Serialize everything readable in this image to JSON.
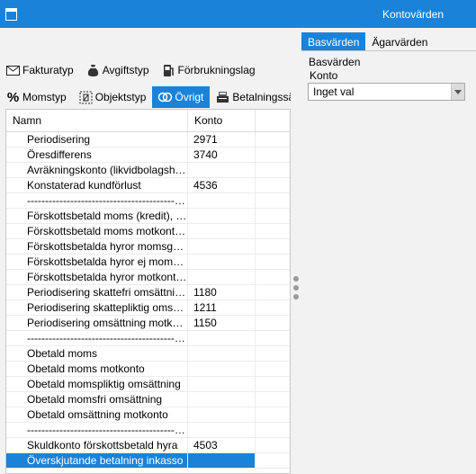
{
  "window": {
    "title": "Kontovärden"
  },
  "tabs_top": [
    {
      "label": "Fakturatyp",
      "icon": "envelope-icon"
    },
    {
      "label": "Avgiftstyp",
      "icon": "money-bag-icon"
    },
    {
      "label": "Förbrukningslag",
      "icon": "pump-icon"
    }
  ],
  "tabs_bottom": [
    {
      "label": "Momstyp",
      "icon": "percent-icon"
    },
    {
      "label": "Objektstyp",
      "icon": "object-icon"
    },
    {
      "label": "Övrigt",
      "icon": "rings-icon",
      "active": true
    },
    {
      "label": "Betalningssätt",
      "icon": "cash-register-icon"
    }
  ],
  "grid": {
    "columns": [
      "Namn",
      "Konto"
    ],
    "rows": [
      {
        "name": "Periodisering",
        "account": "2971"
      },
      {
        "name": "Öresdifferens",
        "account": "3740"
      },
      {
        "name": "Avräkningskonto (likvidbolagshantering)",
        "account": ""
      },
      {
        "name": "Konstaterad kundförlust",
        "account": "4536"
      },
      {
        "name": "--------------------------------------------------------",
        "account": ""
      },
      {
        "name": "Förskottsbetald moms (kredit), användning",
        "account": ""
      },
      {
        "name": "Förskottsbetald moms motkonto (debet)",
        "account": ""
      },
      {
        "name": "Förskottsbetalda hyror momsgrundande",
        "account": ""
      },
      {
        "name": "Förskottsbetalda hyror ej momsgrundande",
        "account": ""
      },
      {
        "name": "Förskottsbetalda hyror motkonto (debet)",
        "account": ""
      },
      {
        "name": "Periodisering skattefri omsättning (kredit)",
        "account": "1180"
      },
      {
        "name": "Periodisering skattepliktig omsättning",
        "account": "1211"
      },
      {
        "name": "Periodisering omsättning motkonto (debet)",
        "account": "1150"
      },
      {
        "name": "--------------------------------------------------------",
        "account": ""
      },
      {
        "name": "Obetald moms",
        "account": ""
      },
      {
        "name": "Obetald moms motkonto",
        "account": ""
      },
      {
        "name": "Obetald momspliktig omsättning",
        "account": ""
      },
      {
        "name": "Obetald momsfri omsättning",
        "account": ""
      },
      {
        "name": "Obetald omsättning motkonto",
        "account": ""
      },
      {
        "name": "--------------------------------------------------------",
        "account": ""
      },
      {
        "name": "Skuldkonto förskottsbetald hyra",
        "account": "4503"
      },
      {
        "name": "Överskjutande betalning inkasso",
        "account": "",
        "selected": true
      }
    ]
  },
  "right_panel": {
    "tabs": [
      {
        "label": "Basvärden",
        "active": true
      },
      {
        "label": "Ägarvärden"
      }
    ],
    "section_label": "Basvärden",
    "field_label": "Konto",
    "select_value": "Inget val"
  },
  "colors": {
    "accent": "#1a82d8",
    "pane_bg": "#f2f2f2"
  }
}
